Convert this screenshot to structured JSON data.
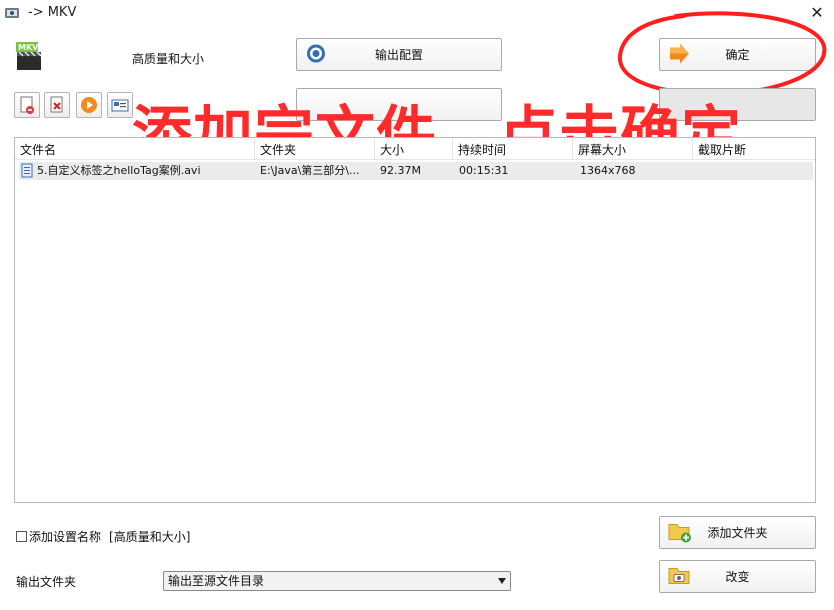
{
  "window": {
    "title": "-> MKV"
  },
  "top": {
    "profile_label": "高质量和大小",
    "output_config_label": "输出配置",
    "confirm_label": "确定"
  },
  "list": {
    "columns": [
      "文件名",
      "文件夹",
      "大小",
      "持续时间",
      "屏幕大小",
      "截取片断"
    ],
    "rows": [
      {
        "name": "5.自定义标签之helloTag案例.avi",
        "folder": "E:\\Java\\第三部分\\...",
        "size": "92.37M",
        "duration": "00:15:31",
        "resolution": "1364x768",
        "clip": ""
      }
    ]
  },
  "bottom": {
    "add_setting_name_label": "添加设置名称",
    "setting_name_value": "[高质量和大小]",
    "add_folder_label": "添加文件夹",
    "output_folder_label": "输出文件夹",
    "output_folder_value": "输出至源文件目录",
    "change_label": "改变"
  },
  "annotation": {
    "text": "添加完文件，点击确定"
  },
  "icons": {
    "app": "app-icon",
    "format": "mkv-icon",
    "gear": "gear-icon",
    "confirm_arrow": "arrow-icon",
    "add_folder": "folder-add-icon",
    "change": "folder-change-icon"
  },
  "colors": {
    "annotation_red": "#ff2a2a"
  }
}
